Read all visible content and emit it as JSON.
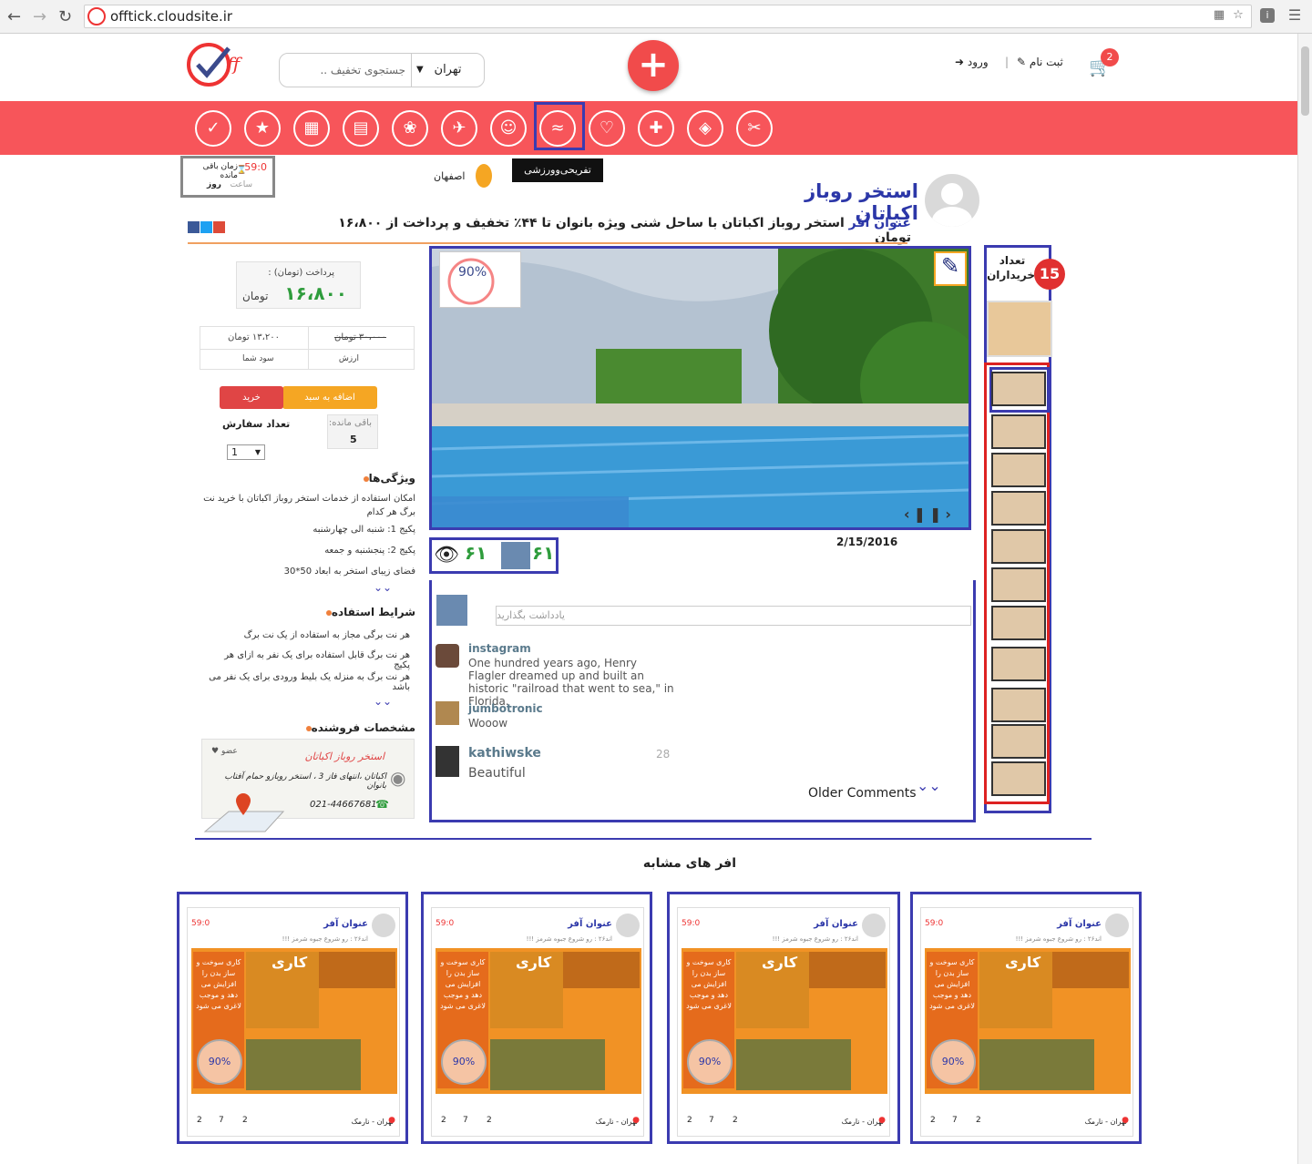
{
  "browser": {
    "url": "offtick.cloudsite.ir"
  },
  "header": {
    "search_placeholder": "جستجوی تخفیف ..",
    "city": "تهران",
    "login": "ورود",
    "register": "ثبت نام",
    "cart_count": "2"
  },
  "timer": {
    "days_label": "روز",
    "hours_label": "ساعت",
    "remaining_label": "زمان باقی مانده",
    "value": "59:0"
  },
  "deal": {
    "category": "تفریحی‌وورزشی",
    "city": "اصفهان",
    "title": "استخر روباز اکباتان",
    "subtitle_key": "عنوان آفر",
    "subtitle": "استخر روباز اکباتان با ساحل شنی ویژه بانوان تا ۴۴٪ تخفیف و پرداخت از ۱۶،۸۰۰ تومان",
    "date": "2/15/2016",
    "views": "۶۱",
    "comments_count": "۶۱"
  },
  "price": {
    "pay_label": "پرداخت (تومان) :",
    "pay_value": "۱۶،۸۰۰",
    "currency": "تومان",
    "original": "۳۰،۰۰۰ تومان",
    "saving": "۱۳،۲۰۰ تومان",
    "original_label": "ارزش",
    "saving_label": "سود شما",
    "add_to_cart": "اضافه به سبد",
    "buy": "خرید",
    "remaining_label": "باقی مانده:",
    "remaining_value": "5",
    "order_count_label": "تعداد سفارش",
    "order_qty": "1"
  },
  "features": {
    "title": "ویژگی‌ها",
    "items": [
      "امکان استفاده از خدمات استخر روباز اکباتان با خرید نت برگ هر کدام",
      "پکیج 1: شنبه الی چهارشنبه",
      "پکیج 2: پنجشنبه و جمعه",
      "فضای زیبای استخر به ابعاد 50*30"
    ]
  },
  "terms": {
    "title": "شرایط استفاده",
    "items": [
      "هر نت برگی مجاز به استفاده از یک نت برگ",
      "هر نت برگ قابل استفاده برای یک نفر به ازای هر پکیج",
      "هر نت برگ به منزله یک بلیط ورودی برای یک نفر می باشد"
    ]
  },
  "seller": {
    "title": "مشخصات فروشنده",
    "name": "استخر روباز اکباتان",
    "address": "اکباتان ،انتهای فاز 3 ، استخر روبازو حمام آفتاب بانوان",
    "phone": "021-44667681",
    "follow": "عضو"
  },
  "comments": {
    "placeholder": "یادداشت بگذارید",
    "items": [
      {
        "user": "instagram",
        "text": "One hundred years ago, Henry Flagler dreamed up and built an historic \"railroad that went to sea,\" in Florida."
      },
      {
        "user": "jumbotronic",
        "text": "Wooow"
      },
      {
        "user": "kathiwske",
        "text": "Beautiful",
        "meta": "28"
      }
    ],
    "older": "Older Comments"
  },
  "buyers": {
    "label_line1": "تعداد",
    "label_line2": "خریداران",
    "count": "15"
  },
  "similar": {
    "title": "افر های مشابه",
    "card_title": "عنوان آفر",
    "card_timer": "59:0",
    "card_sub": "اند۲۶ : رو شروع جبوه شرمز !!!",
    "banner_title": "کاری",
    "banner_text": "کاری سوخت و ساز بدن را افزایش می دهد و موجب لاغری می شود",
    "badge": "90%",
    "location": "تهران - نارمک",
    "stats": [
      "2",
      "7",
      "2"
    ]
  },
  "colors": {
    "brand_red": "#f7555a",
    "frame_blue": "#3b3bb0",
    "title_blue": "#2c37a8",
    "price_green": "#2e9c3c",
    "orange": "#f5a623"
  }
}
